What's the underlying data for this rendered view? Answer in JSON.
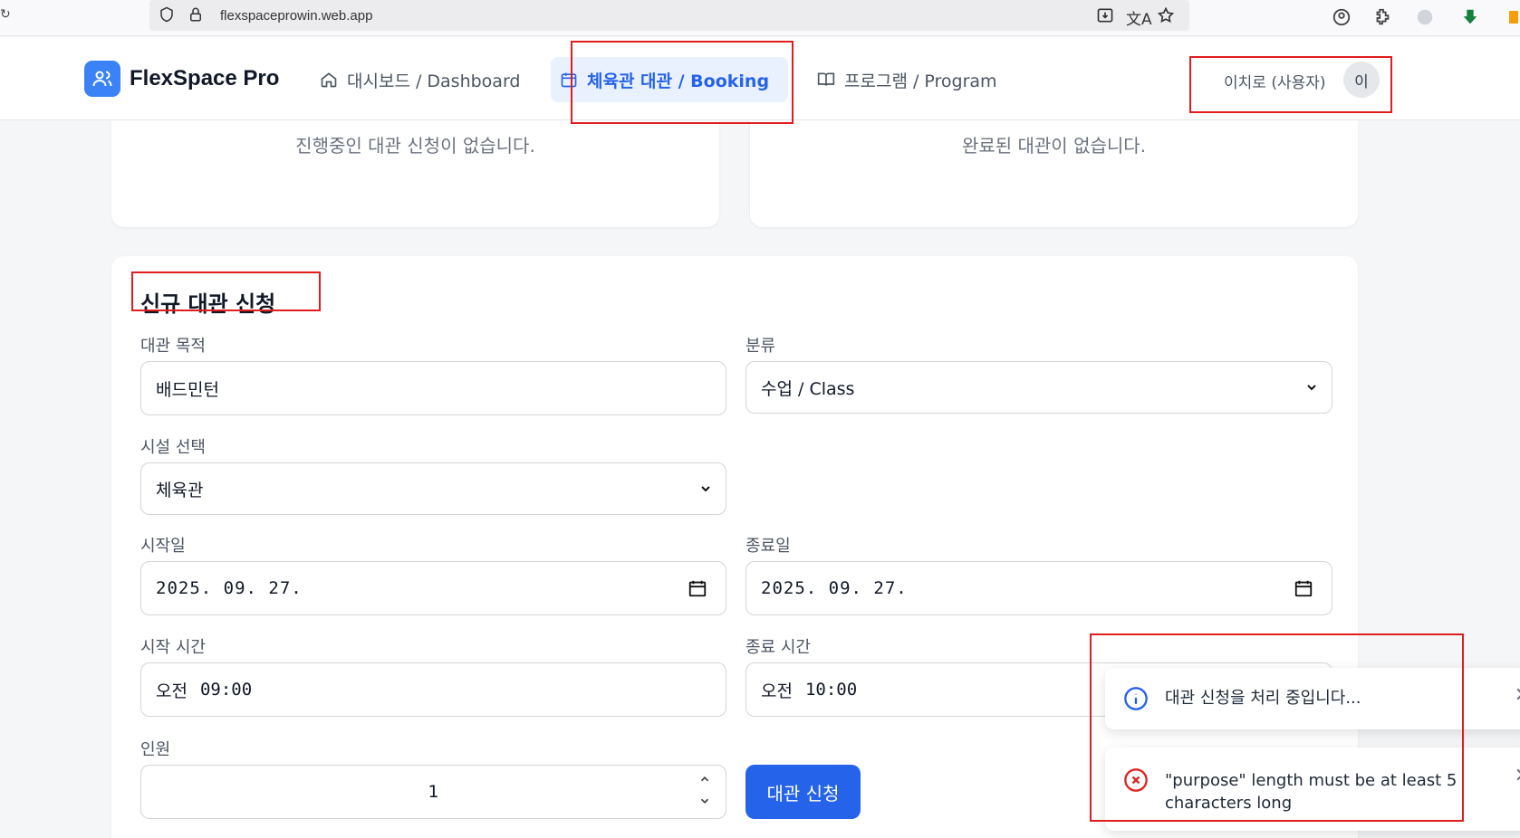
{
  "browser": {
    "url": "flexspaceprowin.web.app"
  },
  "header": {
    "brand": "FlexSpace Pro",
    "nav": [
      {
        "label": "대시보드 / Dashboard",
        "icon": "home-icon"
      },
      {
        "label": "체육관 대관 / Booking",
        "icon": "calendar-icon"
      },
      {
        "label": "프로그램 / Program",
        "icon": "book-icon"
      }
    ],
    "user_name": "이치로 (사용자)",
    "avatar_initial": "이"
  },
  "status_cards": {
    "in_progress_empty": "진행중인 대관 신청이 없습니다.",
    "completed_empty": "완료된 대관이 없습니다."
  },
  "form": {
    "title": "신규 대관 신청",
    "purpose_label": "대관 목적",
    "purpose_value": "배드민턴",
    "category_label": "분류",
    "category_value": "수업 / Class",
    "facility_label": "시설 선택",
    "facility_value": "체육관",
    "start_date_label": "시작일",
    "start_date_value": "2025. 09. 27.",
    "end_date_label": "종료일",
    "end_date_value": "2025. 09. 27.",
    "start_time_label": "시작 시간",
    "start_time_period": "오전",
    "start_time_value": "09:00",
    "end_time_label": "종료 시간",
    "end_time_period": "오전",
    "end_time_value": "10:00",
    "people_label": "인원",
    "people_value": "1",
    "submit_label": "대관 신청"
  },
  "toasts": [
    {
      "type": "info",
      "message": "대관 신청을 처리 중입니다..."
    },
    {
      "type": "error",
      "message_line1": "\"purpose\" length must be at least 5",
      "message_line2": "characters long"
    }
  ],
  "colors": {
    "primary": "#2563eb",
    "logo": "#3b82f6",
    "nav_active_bg": "#eaf1fe",
    "info": "#2563eb",
    "error": "#dc2626",
    "annotation": "#e11d1d"
  }
}
